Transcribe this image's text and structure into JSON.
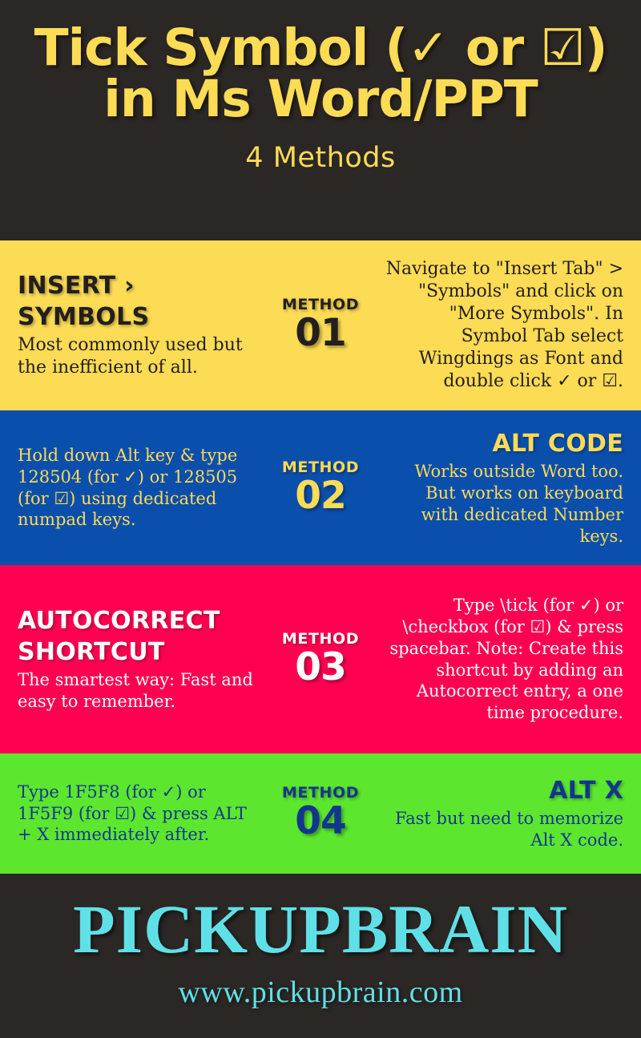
{
  "header": {
    "title_line1": "Tick Symbol (✓ or ☑)",
    "title_line2": "in Ms Word/PPT",
    "subtitle": "4 Methods"
  },
  "colors": {
    "dark": "#2b2725",
    "yellow": "#fcdb55",
    "blue": "#0b4fad",
    "pink": "#ff0050",
    "green": "#5ce62e",
    "navy": "#12368e",
    "white": "#ffffff",
    "cyan": "#5fe0e6"
  },
  "methods": [
    {
      "label": "METHOD",
      "number": "01",
      "background": "#fcdb55",
      "text_color": "#231f1d",
      "left_heading": "INSERT › SYMBOLS",
      "left_body": "Most commonly used but the inefficient of all.",
      "right_heading": "",
      "right_body": "Navigate to \"Insert Tab\" > \"Symbols\" and click on \"More Symbols\". In  Symbol Tab select Wingdings as Font and double click ✓ or ☑."
    },
    {
      "label": "METHOD",
      "number": "02",
      "background": "#0b4fad",
      "text_color": "#fcdb55",
      "left_heading": "",
      "left_body": "Hold down Alt key & type 128504 (for ✓) or 128505 (for ☑) using dedicated numpad keys.",
      "right_heading": "ALT CODE",
      "right_body": "Works outside Word too. But works on keyboard with dedicated Number keys."
    },
    {
      "label": "METHOD",
      "number": "03",
      "background": "#ff0050",
      "text_color": "#ffffff",
      "left_heading": "AUTOCORRECT SHORTCUT",
      "left_body": "The smartest way: Fast and easy to remember.",
      "right_heading": "",
      "right_body": "Type \\tick (for ✓) or \\checkbox (for ☑) & press spacebar. Note: Create this shortcut by adding an Autocorrect entry, a one time procedure."
    },
    {
      "label": "METHOD",
      "number": "04",
      "background": "#5ce62e",
      "text_color": "#12368e",
      "left_heading": "",
      "left_body": "Type 1F5F8 (for ✓) or 1F5F9 (for ☑) & press ALT + X immediately after.",
      "right_heading": "ALT X",
      "right_body": "Fast but need to memorize Alt X code."
    }
  ],
  "footer": {
    "brand": "PICKUPBRAIN",
    "url": "www.pickupbrain.com"
  }
}
